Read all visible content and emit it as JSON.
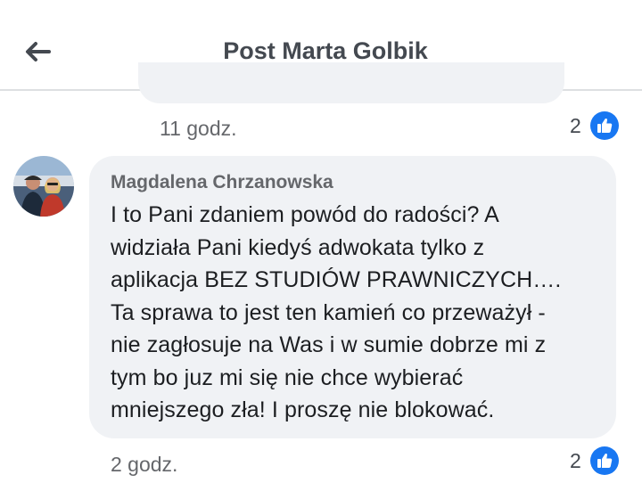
{
  "header": {
    "title": "Post Marta Golbik"
  },
  "previous_comment": {
    "time": "11 godz.",
    "likes": "2"
  },
  "comment": {
    "author": "Magdalena Chrzanowska",
    "lines": [
      "I to Pani zdaniem powód do radości? A",
      "widziała Pani kiedyś adwokata tylko z",
      "aplikacja BEZ STUDIÓW PRAWNICZYCH….",
      "Ta sprawa to jest ten kamień co przeważył -",
      "nie zagłosuje na Was i w sumie dobrze mi z",
      "tym bo juz mi się nie chce wybierać",
      "mniejszego zła! I proszę nie blokować."
    ],
    "time": "2 godz.",
    "likes": "2"
  },
  "colors": {
    "accent": "#1877f2",
    "bubble": "#f0f2f5",
    "muted_text": "#65676b"
  },
  "icons": [
    "back-arrow-icon",
    "like-thumb-icon",
    "avatar"
  ]
}
